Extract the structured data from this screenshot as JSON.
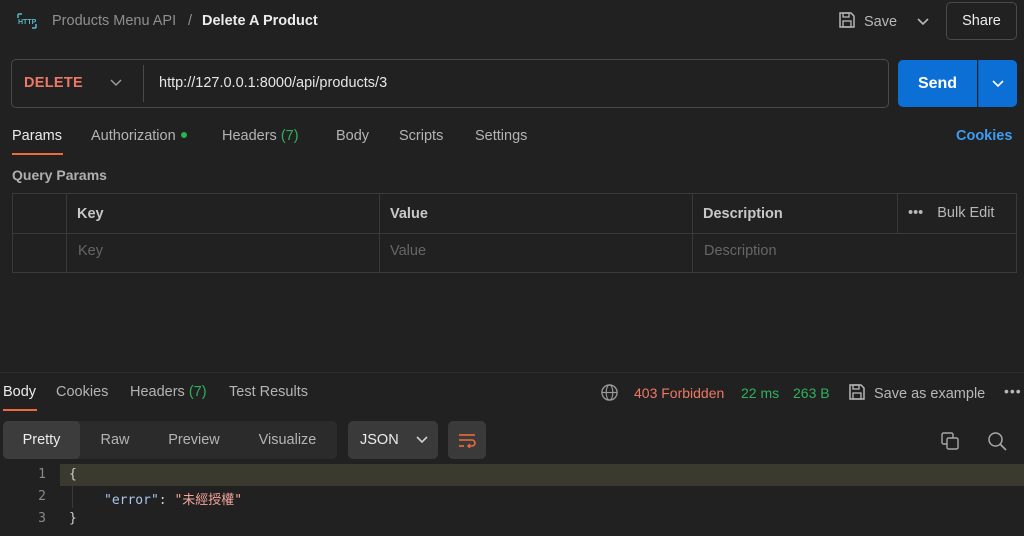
{
  "header": {
    "icon": "http-icon",
    "icon_text": "HTTP",
    "breadcrumb_parent": "Products Menu API",
    "breadcrumb_separator": "/",
    "breadcrumb_current": "Delete A Product",
    "save_label": "Save",
    "share_label": "Share"
  },
  "request": {
    "method": "DELETE",
    "url": "http://127.0.0.1:8000/api/products/3",
    "send_label": "Send"
  },
  "request_tabs": [
    {
      "label": "Params",
      "active": true
    },
    {
      "label": "Authorization",
      "dot": "#2bb24c"
    },
    {
      "label": "Headers",
      "count": "(7)"
    },
    {
      "label": "Body"
    },
    {
      "label": "Scripts"
    },
    {
      "label": "Settings"
    }
  ],
  "cookies_link": "Cookies",
  "query_params": {
    "title": "Query Params",
    "columns": [
      "Key",
      "Value",
      "Description"
    ],
    "placeholders": [
      "Key",
      "Value",
      "Description"
    ],
    "bulk_edit": "Bulk Edit",
    "more": "•••"
  },
  "response": {
    "tabs": [
      {
        "label": "Body",
        "active": true
      },
      {
        "label": "Cookies"
      },
      {
        "label": "Headers",
        "count": "(7)"
      },
      {
        "label": "Test Results"
      }
    ],
    "status": "403 Forbidden",
    "time": "22 ms",
    "size": "263 B",
    "save_example": "Save as example",
    "more": "•••",
    "views": [
      "Pretty",
      "Raw",
      "Preview",
      "Visualize"
    ],
    "active_view": "Pretty",
    "format": "JSON",
    "line_numbers": [
      "1",
      "2",
      "3"
    ],
    "code": {
      "open_brace": "{",
      "key": "\"error\"",
      "colon": ": ",
      "value": "\"未經授權\"",
      "close_brace": "}"
    }
  },
  "colors": {
    "accent_orange": "#ef6a3a",
    "method_delete": "#ef7765",
    "send_blue": "#0c6fd6",
    "success_green": "#31b05c",
    "link_blue": "#3d9df2"
  }
}
